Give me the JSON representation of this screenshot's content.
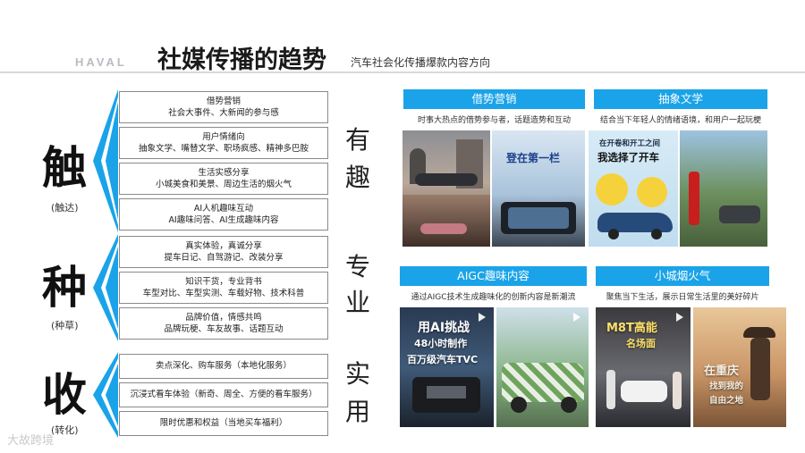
{
  "header": {
    "logo": "HAVAL",
    "title": "社媒传播的趋势",
    "subtitle": "汽车社会化传播爆款内容方向"
  },
  "stages": [
    {
      "char": "触",
      "sub": "(触达)"
    },
    {
      "char": "种",
      "sub": "(种草)"
    },
    {
      "char": "收",
      "sub": "(转化)"
    }
  ],
  "boxes": [
    {
      "line1": "借势营销",
      "line2": "社会大事件、大新闻的参与感"
    },
    {
      "line1": "用户情绪向",
      "line2": "抽象文学、嘴替文学、职场疯感、精神多巴胺"
    },
    {
      "line1": "生活实感分享",
      "line2": "小城美食和美景、周边生活的烟火气"
    },
    {
      "line1": "AI人机趣味互动",
      "line2": "AI趣味问答、AI生成趣味内容"
    },
    {
      "line1": "真实体验，真诚分享",
      "line2": "提车日记、自驾游记、改装分享"
    },
    {
      "line1": "知识干货，专业背书",
      "line2": "车型对比、车型实测、车载好物、技术科普"
    },
    {
      "line1": "品牌价值，情感共鸣",
      "line2": "品牌玩梗、车友故事、话题互动"
    },
    {
      "line1": "卖点深化、购车服务（本地化服务）"
    },
    {
      "line1": "沉浸式看车体验（新奇、周全、方便的看车服务）"
    },
    {
      "line1": "限时优惠和权益（当地买车福利）"
    }
  ],
  "words": [
    "有",
    "趣",
    "专",
    "业",
    "实",
    "用"
  ],
  "panels": [
    {
      "title": "借势营销",
      "desc": "时事大热点的借势参与者，话题造势和互动",
      "cap": "登在第一栏"
    },
    {
      "title": "抽象文学",
      "desc": "结合当下年轻人的情绪语境，和用户一起玩梗",
      "cap1": "在开卷和开工之间",
      "cap2": "我选择了开车"
    },
    {
      "title": "AIGC趣味内容",
      "desc": "通过AIGC技术生成趣味化的创新内容是新潮流",
      "cap1": "用AI挑战",
      "cap2": "48小时制作",
      "cap3": "百万级汽车TVC"
    },
    {
      "title": "小城烟火气",
      "desc": "聚焦当下生活，展示日常生活里的美好碎片",
      "cap1": "M8T高能",
      "cap2": "名场面",
      "cap3": "在重庆",
      "cap4": "找到我的",
      "cap5": "自由之地"
    }
  ],
  "watermark": "大故跨境",
  "colors": {
    "accent": "#1aa3e8",
    "chevron": "#1aa3e8"
  }
}
